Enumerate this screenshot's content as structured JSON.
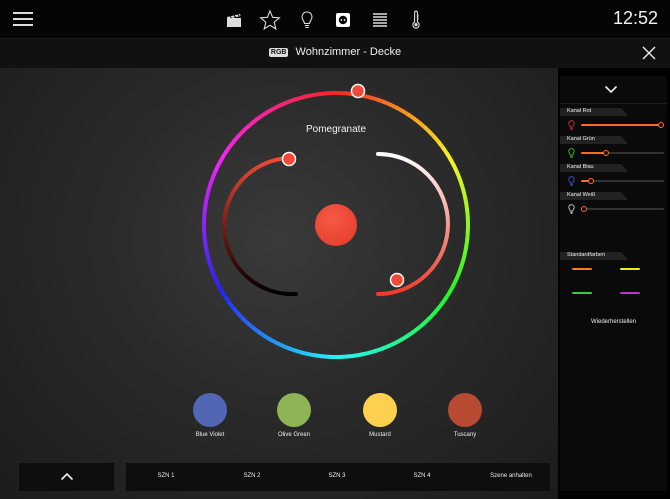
{
  "topbar": {
    "clock": "12:52",
    "icons": [
      "menu-icon",
      "scene-clapper-icon",
      "star-icon",
      "bulb-icon",
      "socket-icon",
      "blinds-icon",
      "thermometer-icon"
    ]
  },
  "titlebar": {
    "badge": "RGB",
    "title": "Wohnzimmer - Decke"
  },
  "wheel": {
    "color_name": "Pomegranate",
    "current_color": "#f04a36"
  },
  "presets": [
    {
      "label": "Blue Violet",
      "color": "#5266b4"
    },
    {
      "label": "Olive Green",
      "color": "#8fb455"
    },
    {
      "label": "Mustard",
      "color": "#fdd14f"
    },
    {
      "label": "Tuscany",
      "color": "#b84a32"
    }
  ],
  "scenes": [
    "SZN 1",
    "SZN 2",
    "SZN 3",
    "SZN 4",
    "Szene anhalten"
  ],
  "panel": {
    "channels": [
      {
        "label": "Kanal Rot",
        "icon_color": "#e83a2a",
        "level": 1.0
      },
      {
        "label": "Kanal Grün",
        "icon_color": "#4ccf3a",
        "level": 0.3
      },
      {
        "label": "Kanal Blau",
        "icon_color": "#4a5ae8",
        "level": 0.12
      },
      {
        "label": "Kanal Weiß",
        "icon_color": "#dddddd",
        "level": 0.0
      }
    ],
    "standard_colors_label": "Standardfarben",
    "standard_colors": [
      "#ff7a1a",
      "#e8ef1a",
      "#2ad33a",
      "#c030d0"
    ],
    "restore_label": "Wiederherstellen"
  },
  "colors": {
    "accent": "#ff6a1a"
  }
}
